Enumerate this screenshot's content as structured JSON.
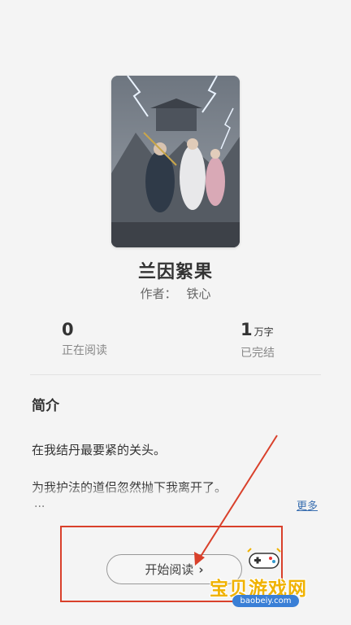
{
  "book": {
    "title": "兰因絮果",
    "author_label": "作者：",
    "author_name": "铁心",
    "cover_icon": "book-cover-illustration"
  },
  "stats": {
    "readers": {
      "value": "0",
      "label": "正在阅读"
    },
    "words": {
      "value": "1",
      "unit": "万字",
      "label": "已完结"
    }
  },
  "synopsis": {
    "heading": "简介",
    "line1": "在我结丹最要紧的关头。",
    "line2": "为我护法的道侣忽然抛下我离开了。",
    "ellipsis": "...",
    "more_label": "更多"
  },
  "actions": {
    "start_reading_label": "开始阅读",
    "start_reading_icon": "chevron-right-icon"
  },
  "watermark": {
    "text": "宝贝游戏网",
    "url": "baobeiy.com",
    "icon": "gamepad-icon"
  },
  "annotation_color": "#d9402b"
}
